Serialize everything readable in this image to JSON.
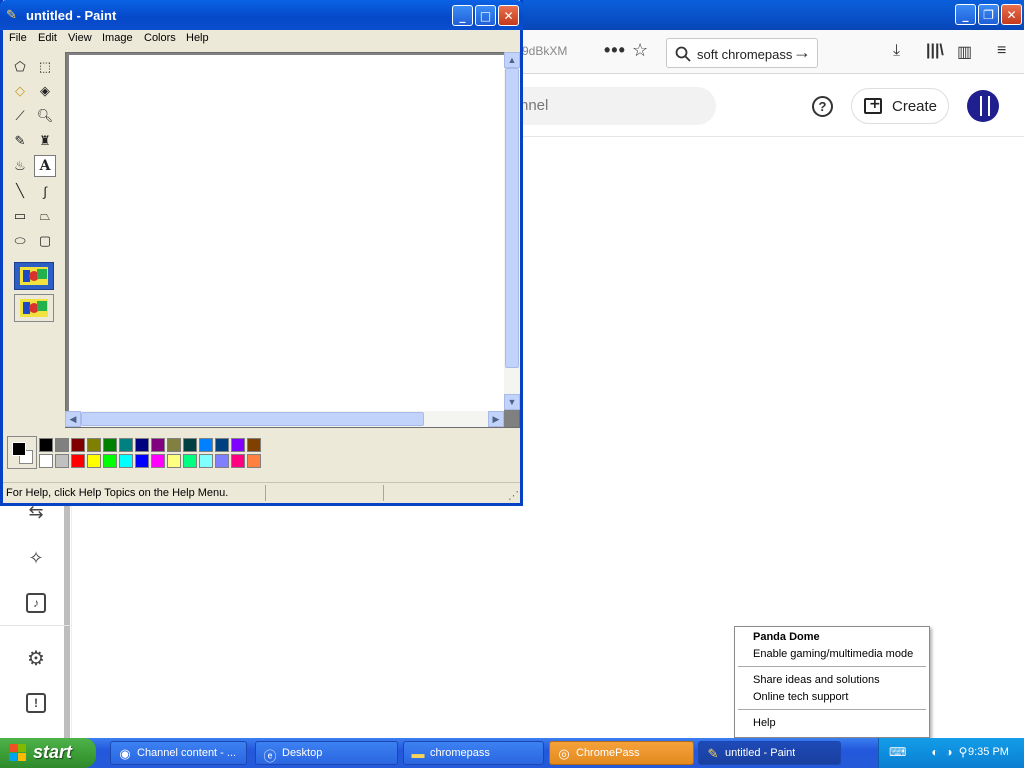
{
  "browser": {
    "url_fragment": "9dBkXM",
    "search_text": "soft chromepass",
    "channel_search_placeholder": "nnel",
    "create_label": "Create",
    "help_symbol": "?"
  },
  "paint": {
    "title": "untitled - Paint",
    "menu": [
      "File",
      "Edit",
      "View",
      "Image",
      "Colors",
      "Help"
    ],
    "status_text": "For Help, click Help Topics on the Help Menu.",
    "palette_top": [
      "#000000",
      "#808080",
      "#800000",
      "#808000",
      "#008000",
      "#008080",
      "#000080",
      "#800080",
      "#808040",
      "#004040",
      "#0080ff",
      "#004080",
      "#8000ff",
      "#804000"
    ],
    "palette_bottom": [
      "#ffffff",
      "#c0c0c0",
      "#ff0000",
      "#ffff00",
      "#00ff00",
      "#00ffff",
      "#0000ff",
      "#ff00ff",
      "#ffff80",
      "#00ff80",
      "#80ffff",
      "#8080ff",
      "#ff0080",
      "#ff8040"
    ],
    "foreground_color": "#000000",
    "background_color": "#ffffff"
  },
  "context_menu": {
    "title": "Panda Dome",
    "item_gaming": "Enable gaming/multimedia mode",
    "item_share": "Share ideas and solutions",
    "item_support": "Online tech support",
    "item_help": "Help"
  },
  "taskbar": {
    "start_label": "start",
    "tasks": [
      {
        "label": "Channel content - ...",
        "icon": "firefox-icon"
      },
      {
        "label": "Desktop",
        "icon": "ie-icon"
      },
      {
        "label": "chromepass",
        "icon": "folder-icon"
      },
      {
        "label": "ChromePass",
        "icon": "chromepass-icon"
      },
      {
        "label": "untitled - Paint",
        "icon": "paint-icon"
      }
    ],
    "clock": "9:35 PM"
  },
  "colors": {
    "xp_blue": "#0a5fdc",
    "start_green": "#3a9b35",
    "tray_blue": "#0b7fd1",
    "orange_task": "#e38a1e"
  }
}
